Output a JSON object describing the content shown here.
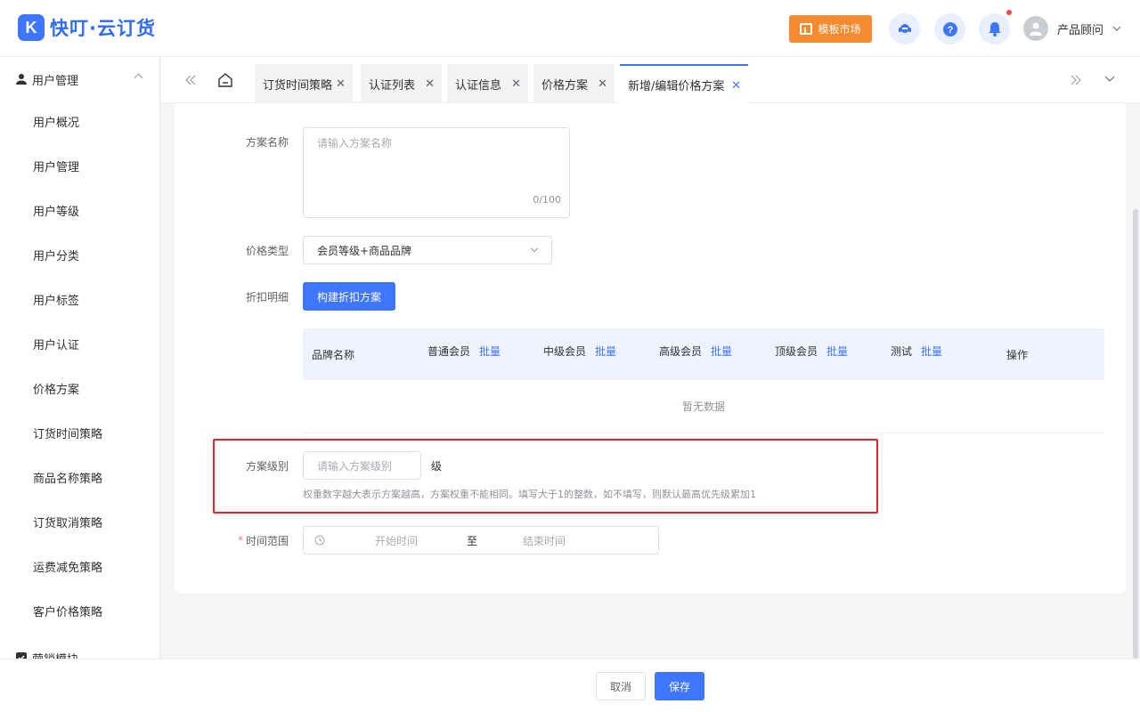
{
  "app": {
    "logo_mark": "K",
    "title": "快叮·云订货"
  },
  "header": {
    "template_market": "模板市场",
    "user_name": "产品顾问",
    "icons": [
      "support-icon",
      "help-icon",
      "bell-icon"
    ],
    "accent": "#3f76ff",
    "orange": "#f58a2e"
  },
  "sidebar": {
    "group_title": "用户管理",
    "items": [
      "用户概况",
      "用户管理",
      "用户等级",
      "用户分类",
      "用户标签",
      "用户认证",
      "价格方案",
      "订货时间策略",
      "商品名称策略",
      "订货取消策略",
      "运费减免策略",
      "客户价格策略"
    ],
    "next_group": "营销模块"
  },
  "tabs": [
    {
      "label": "订货时间策略"
    },
    {
      "label": "认证列表"
    },
    {
      "label": "认证信息"
    },
    {
      "label": "价格方案"
    },
    {
      "label": "新增/编辑价格方案"
    }
  ],
  "form": {
    "name_label": "方案名称",
    "name_placeholder": "请输入方案名称",
    "name_counter": "0/100",
    "price_type_label": "价格类型",
    "price_type_value": "会员等级+商品品牌",
    "discount_label": "折扣明细",
    "build_button": "构建折扣方案",
    "table": {
      "col_brand": "品牌名称",
      "levels": [
        "普通会员",
        "中级会员",
        "高级会员",
        "顶级会员",
        "测试"
      ],
      "batch": "批量",
      "col_action": "操作",
      "empty": "暂无数据"
    },
    "level_label": "方案级别",
    "level_placeholder": "请输入方案级别",
    "level_unit": "级",
    "level_hint": "权重数字越大表示方案越高，方案权重不能相同。填写大于1的整数，如不填写，则默认最高优先级累加1",
    "time_required": "*",
    "time_label": "时间范围",
    "start_placeholder": "开始时间",
    "range_sep": "至",
    "end_placeholder": "结束时间"
  },
  "footer": {
    "cancel": "取消",
    "save": "保存"
  }
}
